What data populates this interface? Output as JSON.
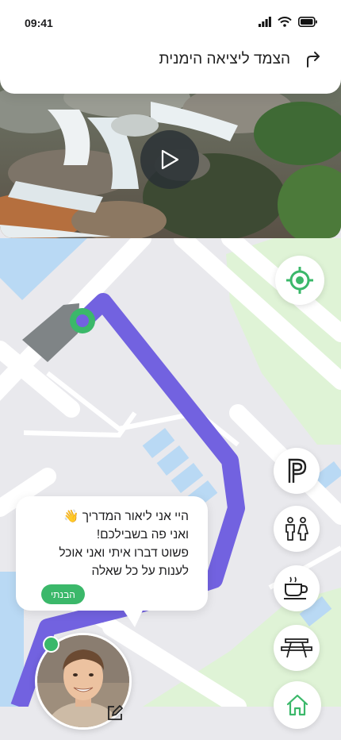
{
  "status_bar": {
    "time": "09:41"
  },
  "navigation": {
    "instruction": "הצמד ליציאה הימנית",
    "turn_icon": "turn-right-arrow-icon"
  },
  "video": {
    "play_icon": "play-icon",
    "scene": "waterfall-stream"
  },
  "map": {
    "controls": [
      {
        "name": "locate",
        "icon": "locate-crosshair-icon"
      },
      {
        "name": "parking",
        "icon": "parking-icon",
        "label": "P"
      },
      {
        "name": "restrooms",
        "icon": "restroom-icon"
      },
      {
        "name": "cafe",
        "icon": "coffee-cup-icon"
      },
      {
        "name": "picnic",
        "icon": "picnic-table-icon"
      },
      {
        "name": "home",
        "icon": "home-icon"
      }
    ],
    "colors": {
      "route": "#7262e0",
      "park": "#dff3d6",
      "water": "#b9d9f4",
      "accent": "#3bb86a"
    }
  },
  "guide": {
    "message_lines": [
      "היי אני ליאור המדריך 👋",
      "ואני פה בשבילכם!",
      "פשוט דברו איתי ואני אוכל",
      "לענות על כל שאלה"
    ],
    "ack_label": "הבנתי",
    "status": "online",
    "edit_icon": "edit-icon"
  }
}
